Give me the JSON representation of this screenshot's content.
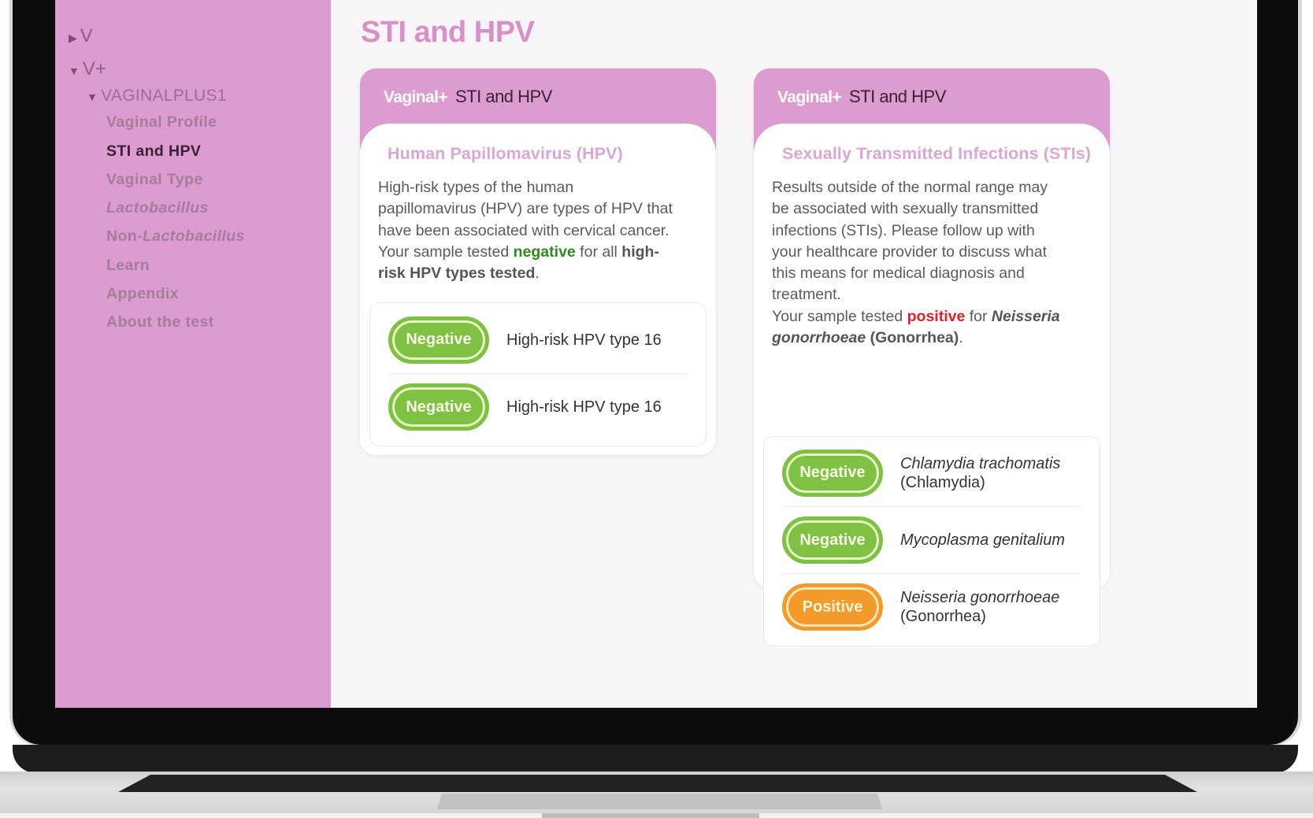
{
  "sidebar": {
    "tree": [
      {
        "label": "V",
        "caret": "▶",
        "expanded": false
      },
      {
        "label": "V+",
        "caret": "▼",
        "expanded": true
      },
      {
        "label": "VAGINALPLUS1",
        "caret": "▼",
        "expanded": true
      }
    ],
    "items": [
      {
        "label": "Vaginal Profile",
        "active": false
      },
      {
        "label": "STI and HPV",
        "active": true
      },
      {
        "label": "Vaginal Type",
        "active": false
      },
      {
        "label": "Lactobacillus",
        "active": false
      },
      {
        "label_prefix": "Non-",
        "label_italic": "Lactobacillus",
        "active": false
      },
      {
        "label": "Learn",
        "active": false
      },
      {
        "label": "Appendix",
        "active": false
      },
      {
        "label": "About the test",
        "active": false
      }
    ]
  },
  "page": {
    "title": "STI and HPV"
  },
  "cards": [
    {
      "brand": "Vaginal+",
      "header_title": "STI and HPV",
      "section_title": "Human Papillomavirus (HPV)",
      "desc_lines": [
        "High-risk types of the human",
        "papillomavirus (HPV) are types of HPV that",
        "have been associated with cervical cancer."
      ],
      "summary": {
        "prefix": "Your sample tested ",
        "status": "negative",
        "middle": " for all ",
        "bold_line1": "high-",
        "bold_line2": "risk HPV types tested",
        "suffix": "."
      },
      "results": [
        {
          "status": "Negative",
          "label": "High-risk HPV type 16"
        },
        {
          "status": "Negative",
          "label": "High-risk HPV type 16"
        }
      ]
    },
    {
      "brand": "Vaginal+",
      "header_title": "STI and HPV",
      "section_title": "Sexually Transmitted Infections (STIs)",
      "desc_lines": [
        "Results outside of the normal range may",
        "be associated with sexually transmitted",
        "infections (STIs). Please follow up with",
        "your healthcare provider to discuss what",
        "this means for medical diagnosis and",
        "treatment."
      ],
      "summary": {
        "prefix": "Your sample tested ",
        "status": "positive",
        "middle": " for ",
        "organism_line1": "Neisseria",
        "organism_line2": "gonorrhoeae",
        "common": " (Gonorrhea)",
        "suffix": "."
      },
      "results": [
        {
          "status": "Negative",
          "sci": "Chlamydia trachomatis",
          "common": "(Chlamydia)"
        },
        {
          "status": "Negative",
          "sci": "Mycoplasma genitalium",
          "common": ""
        },
        {
          "status": "Positive",
          "sci": "Neisseria gonorrhoeae",
          "common": "(Gonorrhea)"
        }
      ]
    }
  ],
  "colors": {
    "sidebar_bg": "#dc9ccf",
    "accent_pink": "#d990c6",
    "negative_green": "#7fc142",
    "positive_orange": "#f29a2a",
    "negative_text": "#2e8b1f",
    "positive_text": "#e0202a"
  }
}
